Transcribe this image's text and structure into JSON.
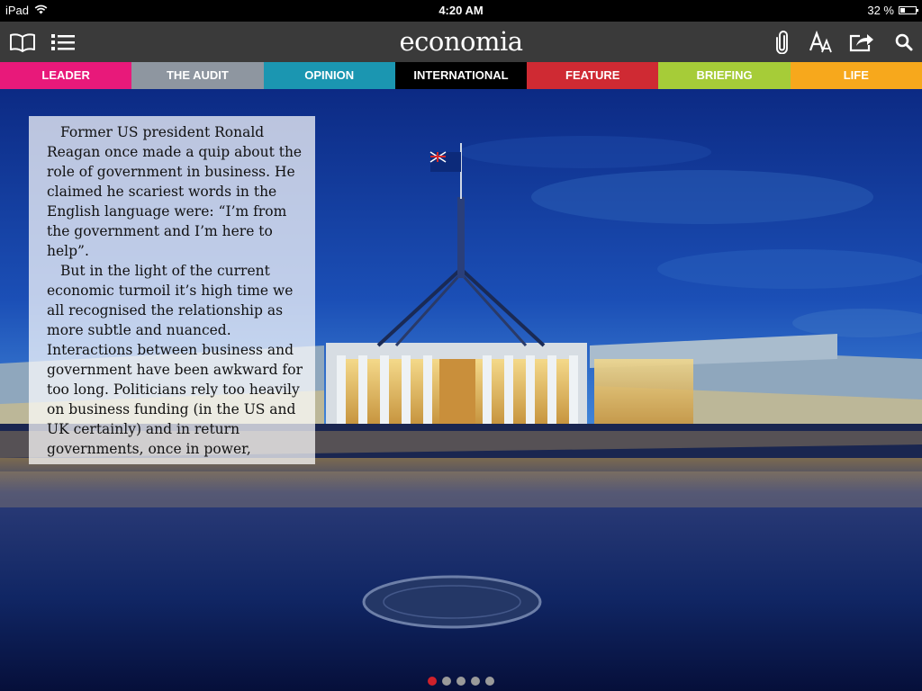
{
  "status_bar": {
    "carrier": "iPad",
    "time": "4:20 AM",
    "battery": "32 %",
    "battery_level": 0.32
  },
  "toolbar": {
    "logo": "economia",
    "icons": [
      "book-icon",
      "list-icon",
      "paperclip-icon",
      "font-size-icon",
      "share-icon",
      "search-icon"
    ]
  },
  "tabs": [
    {
      "label": "LEADER",
      "color": "#e8197a"
    },
    {
      "label": "THE AUDIT",
      "color": "#8e96a0"
    },
    {
      "label": "OPINION",
      "color": "#1b96b1"
    },
    {
      "label": "INTERNATIONAL",
      "color": "#000000"
    },
    {
      "label": "FEATURE",
      "color": "#cf2a33",
      "active": true
    },
    {
      "label": "BRIEFING",
      "color": "#a6cc38"
    },
    {
      "label": "LIFE",
      "color": "#f7a81c"
    }
  ],
  "article": {
    "paragraphs": [
      "Former US president Ronald Reagan once made a quip about the role of government in business. He claimed  he scariest words in the English language were: “I’m from the government and I’m here to help”.",
      "But in the light of the current economic turmoil it’s high time we all recognised the relationship as more subtle and nuanced. Interactions between business and government have been awkward for too long. Politicians rely too heavily on business funding (in the US and UK certainly) and in return governments, once in power,"
    ]
  },
  "pagination": {
    "total": 5,
    "current": 1
  }
}
